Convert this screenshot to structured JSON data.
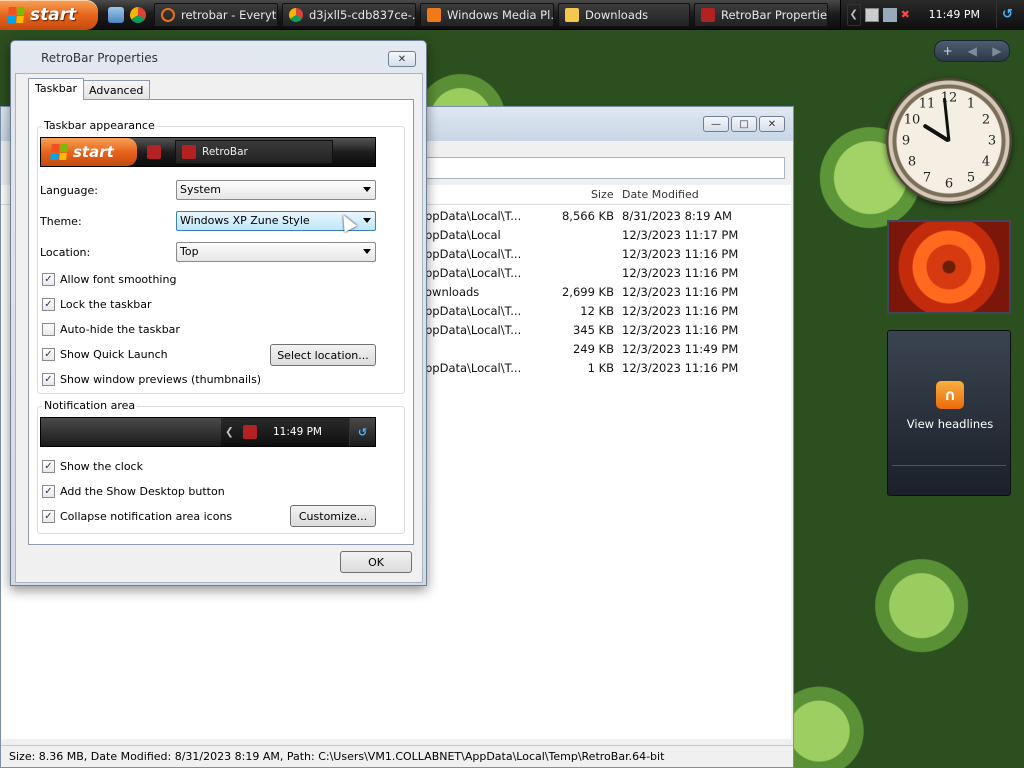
{
  "taskbar": {
    "start_label": "start",
    "buttons": [
      {
        "label": "retrobar - Everyt...",
        "icon": "magnifier-icon",
        "color": "#e8701a"
      },
      {
        "label": "d3jxll5-cdb837ce-...",
        "icon": "chrome-icon",
        "color": "#3a9b3a"
      },
      {
        "label": "Windows Media Pl...",
        "icon": "media-player-icon",
        "color": "#f07a1a"
      },
      {
        "label": "Downloads",
        "icon": "folder-icon",
        "color": "#f2c94c"
      },
      {
        "label": "RetroBar Properties",
        "icon": "retrobar-icon",
        "color": "#b22222"
      }
    ],
    "clock": "11:49 PM"
  },
  "explorer": {
    "headers": {
      "size": "Size",
      "date": "Date Modified"
    },
    "rows": [
      {
        "path": "ppData\\Local\\T...",
        "size": "8,566 KB",
        "date": "8/31/2023 8:19 AM"
      },
      {
        "path": "ppData\\Local",
        "size": "",
        "date": "12/3/2023 11:17 PM"
      },
      {
        "path": "ppData\\Local\\T...",
        "size": "",
        "date": "12/3/2023 11:16 PM"
      },
      {
        "path": "ppData\\Local\\T...",
        "size": "",
        "date": "12/3/2023 11:16 PM"
      },
      {
        "path": "ownloads",
        "size": "2,699 KB",
        "date": "12/3/2023 11:16 PM"
      },
      {
        "path": "ppData\\Local\\T...",
        "size": "12 KB",
        "date": "12/3/2023 11:16 PM"
      },
      {
        "path": "ppData\\Local\\T...",
        "size": "345 KB",
        "date": "12/3/2023 11:16 PM"
      },
      {
        "path": "",
        "size": "249 KB",
        "date": "12/3/2023 11:49 PM"
      },
      {
        "path": "ppData\\Local\\T...",
        "size": "1 KB",
        "date": "12/3/2023 11:16 PM"
      }
    ],
    "status": "Size: 8.36 MB, Date Modified: 8/31/2023 8:19 AM, Path: C:\\Users\\VM1.COLLABNET\\AppData\\Local\\Temp\\RetroBar.64-bit"
  },
  "gadgets": {
    "rss_label": "View headlines"
  },
  "dialog": {
    "title": "RetroBar Properties",
    "tabs": [
      "Taskbar",
      "Advanced"
    ],
    "taskbar_group": "Taskbar appearance",
    "preview_start": "start",
    "preview_task": "RetroBar",
    "language_label": "Language:",
    "language_value": "System",
    "theme_label": "Theme:",
    "theme_value": "Windows XP Zune Style",
    "location_label": "Location:",
    "location_value": "Top",
    "checks": [
      {
        "label": "Allow font smoothing",
        "checked": true
      },
      {
        "label": "Lock the taskbar",
        "checked": true
      },
      {
        "label": "Auto-hide the taskbar",
        "checked": false
      },
      {
        "label": "Show Quick Launch",
        "checked": true
      },
      {
        "label": "Show window previews (thumbnails)",
        "checked": true
      }
    ],
    "select_location_button": "Select location...",
    "notif_group": "Notification area",
    "notif_clock": "11:49 PM",
    "notif_checks": [
      {
        "label": "Show the clock",
        "checked": true
      },
      {
        "label": "Add the Show Desktop button",
        "checked": true
      },
      {
        "label": "Collapse notification area icons",
        "checked": true
      }
    ],
    "customize_button": "Customize...",
    "ok_button": "OK"
  }
}
